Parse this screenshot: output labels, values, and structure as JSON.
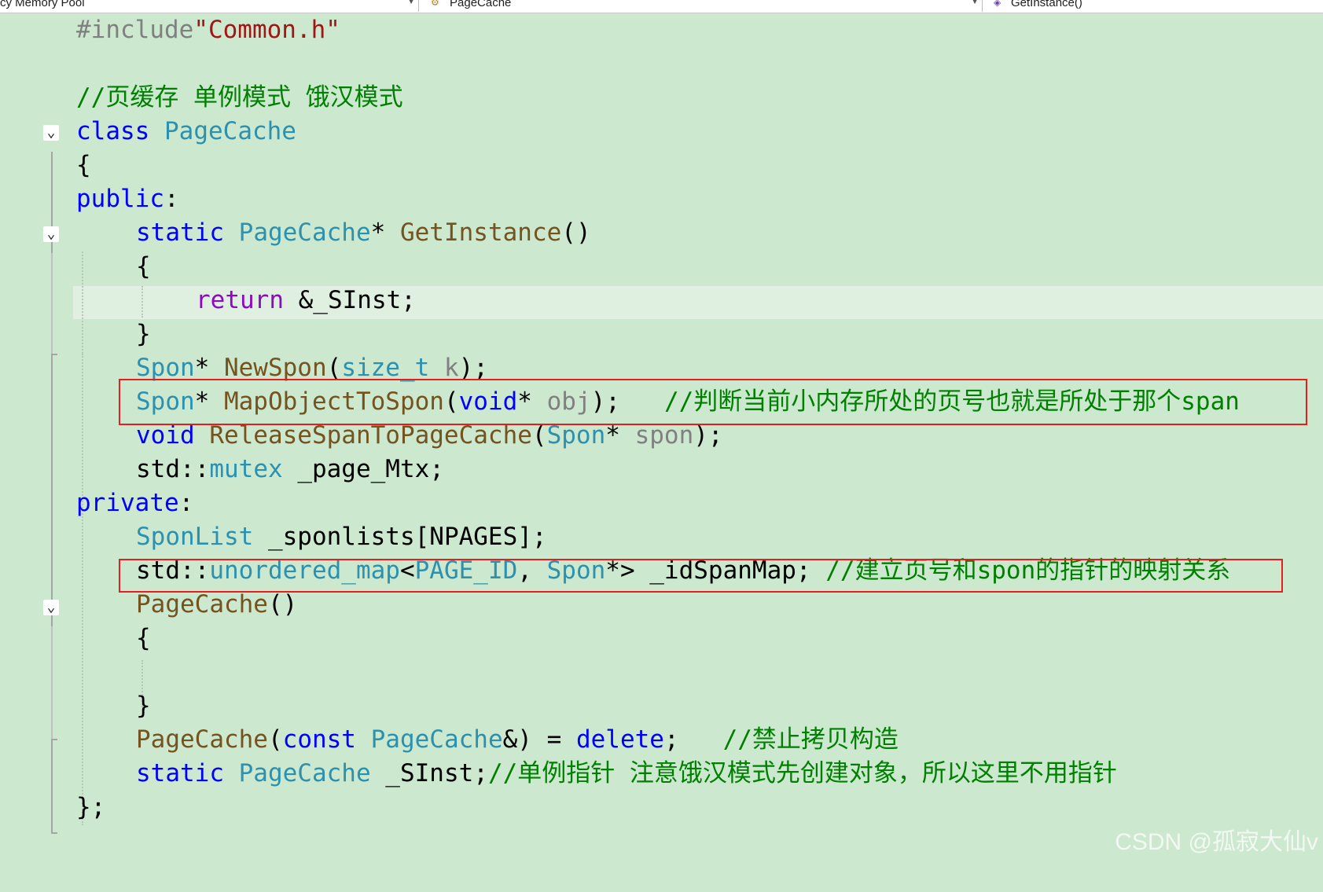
{
  "toolbar": {
    "project_dropdown": "cy Memory Pool",
    "class_dropdown": "PageCache",
    "member_dropdown": "GetInstance()",
    "class_icon": "class-icon",
    "member_icon": "method-icon"
  },
  "code": {
    "l1": {
      "pp": "#include",
      "str": "\"Common.h\""
    },
    "l3": {
      "comment": "//页缓存 单例模式 饿汉模式"
    },
    "l4": {
      "kw": "class",
      "ty": "PageCache"
    },
    "l5": {
      "t": "{"
    },
    "l6": {
      "kw": "public",
      "p": ":"
    },
    "l7": {
      "kw": "static",
      "ty": "PageCache",
      "p1": "* ",
      "fn": "GetInstance",
      "p2": "()"
    },
    "l8": {
      "t": "{"
    },
    "l9": {
      "kw": "return",
      "rest": " &_SInst;"
    },
    "l10": {
      "t": "}"
    },
    "l11": {
      "ty": "Spon",
      "p1": "* ",
      "fn": "NewSpon",
      "p2": "(",
      "ty2": "size_t",
      "prm": " k",
      "p3": ");"
    },
    "l12": {
      "ty": "Spon",
      "p1": "* ",
      "fn": "MapObjectToSpon",
      "p2": "(",
      "kw": "void",
      "p3": "* ",
      "prm": "obj",
      "p4": ");   ",
      "comment": "//判断当前小内存所处的页号也就是所处于那个span"
    },
    "l13": {
      "kw": "void",
      "fn": " ReleaseSpanToPageCache",
      "p1": "(",
      "ty": "Spon",
      "p2": "* ",
      "prm": "spon",
      "p3": ");"
    },
    "l14": {
      "p1": "std::",
      "ty": "mutex",
      "p2": " _page_Mtx;"
    },
    "l15": {
      "kw": "private",
      "p": ":"
    },
    "l16": {
      "ty": "SponList",
      "p": " _sponlists[NPAGES];"
    },
    "l17": {
      "p1": "std::",
      "ty": "unordered_map",
      "p2": "<",
      "ty2": "PAGE_ID",
      "p3": ", ",
      "ty3": "Spon",
      "p4": "*> _idSpanMap; ",
      "comment": "//建立页号和spon的指针的映射关系"
    },
    "l18": {
      "fn": "PageCache",
      "p": "()"
    },
    "l19": {
      "t": "{"
    },
    "l21": {
      "t": "}"
    },
    "l22": {
      "fn": "PageCache",
      "p1": "(",
      "kw": "const",
      "ty": " PageCache",
      "p2": "&) = ",
      "kw2": "delete",
      "p3": ";   ",
      "comment": "//禁止拷贝构造"
    },
    "l23": {
      "kw": "static",
      "ty": " PageCache",
      "p": " _SInst;",
      "comment": "//单例指针 注意饿汉模式先创建对象，所以这里不用指针"
    },
    "l24": {
      "t": "};"
    }
  },
  "icons": {
    "fold": "collapse-chevron-icon"
  },
  "colors": {
    "background": "#cce8cf",
    "keyword": "#0000ff",
    "type": "#2b91af",
    "function": "#74531f",
    "comment": "#008000",
    "string": "#a31515",
    "control": "#8f08c4",
    "highlight_box": "#e81e1e"
  },
  "watermark": "CSDN @孤寂大仙v"
}
